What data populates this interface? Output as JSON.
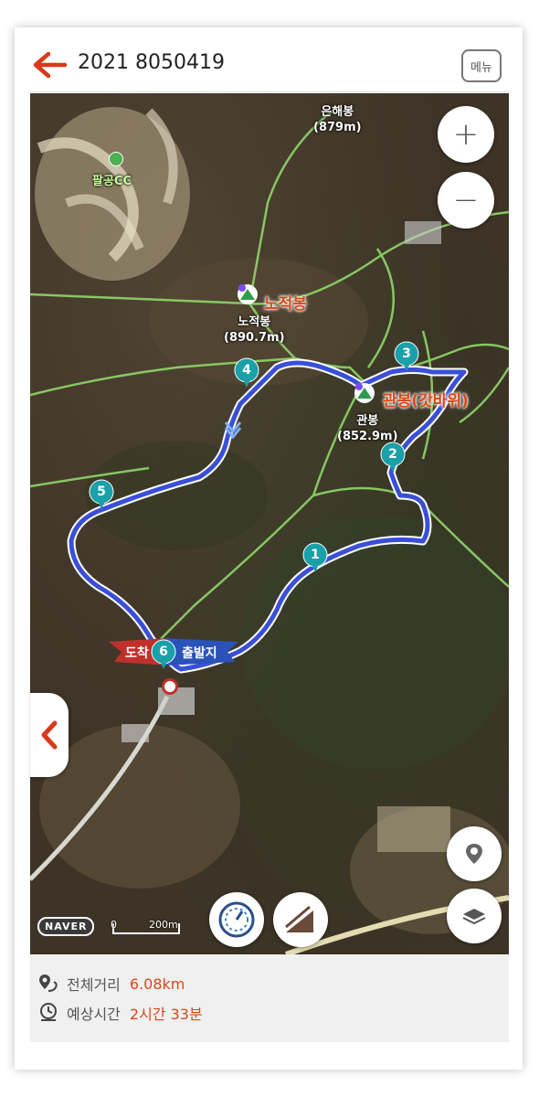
{
  "header": {
    "title": "2021 8050419",
    "menu_label": "메뉴"
  },
  "map": {
    "peaks": [
      {
        "name": "은해봉",
        "elev": "(879m)"
      },
      {
        "name": "노적봉",
        "elev": "(890.7m)"
      },
      {
        "name": "관봉",
        "elev": "(852.9m)"
      }
    ],
    "poi": [
      {
        "name": "팔공CC"
      },
      {
        "name": "노적봉"
      },
      {
        "name": "관봉(갓바위)"
      }
    ],
    "waypoints": [
      "1",
      "2",
      "3",
      "4",
      "5",
      "6"
    ],
    "arrive_label": "도착",
    "depart_label": "출발지",
    "zoom_in": "+",
    "zoom_out": "−",
    "provider": "NAVER",
    "scale_start": "0",
    "scale_end": "200m",
    "route_color": "#3a4fd8",
    "trail_color": "#8fd66a"
  },
  "stats": {
    "distance_label": "전체거리",
    "distance_value": "6.08km",
    "time_label": "예상시간",
    "time_value": "2시간 33분"
  }
}
